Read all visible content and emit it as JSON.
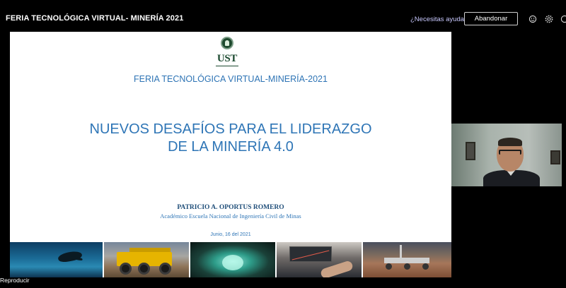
{
  "topbar": {
    "title": "FERIA TECNOLÓGICA VIRTUAL- MINERÍA 2021",
    "help_link": "¿Necesitas ayuda?",
    "leave_button": "Abandonar",
    "icons": [
      "reaction-icon",
      "gear-icon",
      "info-icon"
    ]
  },
  "slide": {
    "logo_text": "UST",
    "fair_title": "FERIA TECNOLÓGICA VIRTUAL-MINERÍA-2021",
    "main_title_line1": "NUEVOS DESAFÍOS PARA EL LIDERAZGO",
    "main_title_line2": "DE LA MINERÍA 4.0",
    "presenter_name": "PATRICIO A. OPORTUS ROMERO",
    "presenter_role": "Académico Escuela Nacional de Ingeniería Civil de Minas",
    "date": "Junio, 16 del 2021",
    "image_strip": [
      "ocean-turtle-image",
      "mining-truck-image",
      "mine-tunnel-image",
      "finance-chart-image",
      "mars-rover-image"
    ]
  },
  "participant_video": {
    "label": "presenter-webcam"
  },
  "player": {
    "play_label": "Reproducir"
  }
}
